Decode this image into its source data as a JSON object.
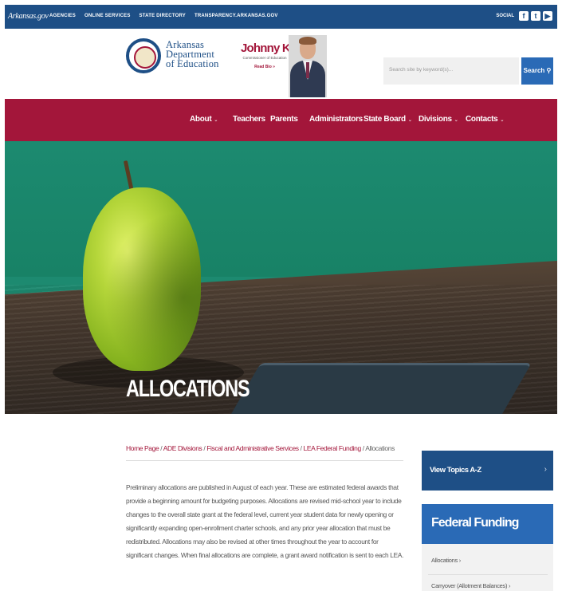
{
  "topbar": {
    "brand": "Arkansas.gov",
    "links": [
      "AGENCIES",
      "ONLINE SERVICES",
      "STATE DIRECTORY",
      "TRANSPARENCY.ARKANSAS.GOV"
    ],
    "social_label": "SOCIAL",
    "social_icons": [
      "facebook-icon",
      "twitter-icon",
      "youtube-icon"
    ]
  },
  "header": {
    "dept_line1": "Arkansas",
    "dept_line2": "Department",
    "dept_line3": "of Education",
    "commissioner_name": "Johnny Key",
    "commissioner_title": "Commissioner of Education",
    "read_bio": "Read Bio »",
    "search_placeholder": "Search site by keyword(s)...",
    "search_button": "Search"
  },
  "nav": {
    "items": [
      {
        "label": "About",
        "dropdown": true
      },
      {
        "label": "Teachers",
        "dropdown": false
      },
      {
        "label": "Parents",
        "dropdown": false
      },
      {
        "label": "Administrators",
        "dropdown": false
      },
      {
        "label": "State Board",
        "dropdown": true
      },
      {
        "label": "Divisions",
        "dropdown": true
      },
      {
        "label": "Contacts",
        "dropdown": true
      }
    ],
    "caret": "⌄"
  },
  "hero": {
    "title": "ALLOCATIONS"
  },
  "breadcrumb": {
    "items": [
      "Home Page",
      "ADE Divisions",
      "Fiscal and Administrative Services",
      "LEA Federal Funding"
    ],
    "current": "Allocations",
    "separator": " / "
  },
  "body": {
    "paragraph": "Preliminary allocations are published in August of each year.  These are estimated federal awards that provide a beginning amount for budgeting purposes.  Allocations are revised mid-school year to include changes to the overall state grant at the federal level, current year student data for newly opening or significantly expanding open-enrollment charter schools, and any prior year allocation that must be redistributed.  Allocations may also be revised at other times throughout the year to account for significant changes.  When final allocations are complete, a grant award notification is sent to each LEA."
  },
  "sidebar": {
    "view_topics": "View Topics A-Z",
    "view_topics_chevron": "›",
    "federal_funding_title": "Federal Funding",
    "links": [
      "Allocations ›",
      "Carryover (Allotment Balances) ›"
    ]
  },
  "colors": {
    "topbar": "#1e4f86",
    "nav": "#a3163a",
    "accent_blue": "#2a6ab6",
    "link_red": "#a3163a"
  }
}
